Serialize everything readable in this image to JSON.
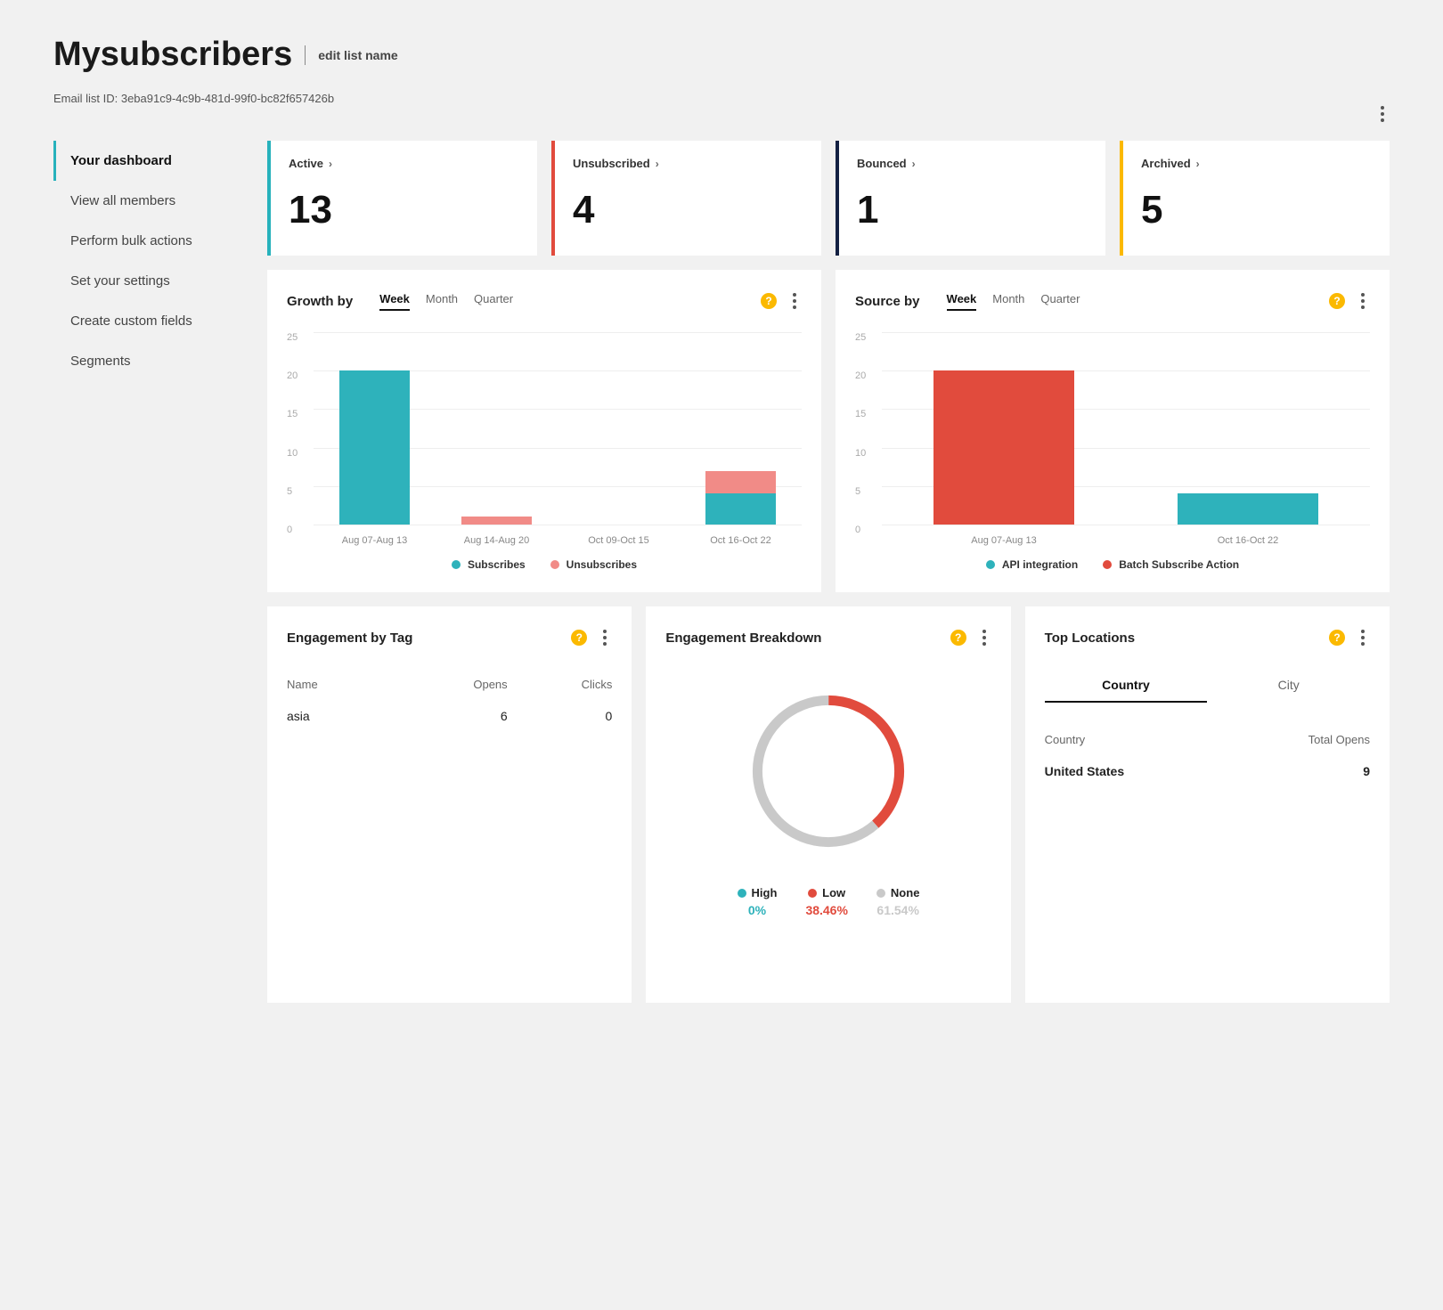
{
  "header": {
    "title": "Mysubscribers",
    "edit_link": "edit list name",
    "list_id_label": "Email list ID: 3eba91c9-4c9b-481d-99f0-bc82f657426b"
  },
  "sidebar": {
    "items": [
      {
        "label": "Your dashboard",
        "active": true
      },
      {
        "label": "View all members",
        "active": false
      },
      {
        "label": "Perform bulk actions",
        "active": false
      },
      {
        "label": "Set your settings",
        "active": false
      },
      {
        "label": "Create custom fields",
        "active": false
      },
      {
        "label": "Segments",
        "active": false
      }
    ]
  },
  "stats": [
    {
      "label": "Active",
      "value": "13",
      "color": "c-teal"
    },
    {
      "label": "Unsubscribed",
      "value": "4",
      "color": "c-red"
    },
    {
      "label": "Bounced",
      "value": "1",
      "color": "c-navy"
    },
    {
      "label": "Archived",
      "value": "5",
      "color": "c-yel"
    }
  ],
  "period_tabs": [
    {
      "label": "Week",
      "active": true
    },
    {
      "label": "Month",
      "active": false
    },
    {
      "label": "Quarter",
      "active": false
    }
  ],
  "growth_card": {
    "title": "Growth by"
  },
  "source_card": {
    "title": "Source by"
  },
  "chart_data": [
    {
      "id": "growth",
      "type": "bar",
      "title": "Growth by (Week)",
      "ylabel": "",
      "ylim": [
        0,
        25
      ],
      "yticks": [
        0,
        5,
        10,
        15,
        20,
        25
      ],
      "categories": [
        "Aug 07-Aug 13",
        "Aug 14-Aug 20",
        "Oct 09-Oct 15",
        "Oct 16-Oct 22"
      ],
      "series": [
        {
          "name": "Subscribes",
          "color": "#2eb2bb",
          "values": [
            20,
            0,
            0,
            4
          ]
        },
        {
          "name": "Unsubscribes",
          "color": "#f18b87",
          "values": [
            0,
            1,
            0,
            3
          ]
        }
      ]
    },
    {
      "id": "source",
      "type": "bar",
      "title": "Source by (Week)",
      "ylabel": "",
      "ylim": [
        0,
        25
      ],
      "yticks": [
        0,
        5,
        10,
        15,
        20,
        25
      ],
      "categories": [
        "Aug 07-Aug 13",
        "Oct 16-Oct 22"
      ],
      "series": [
        {
          "name": "API integration",
          "color": "#2eb2bb",
          "values": [
            0,
            4
          ]
        },
        {
          "name": "Batch Subscribe Action",
          "color": "#e14b3d",
          "values": [
            20,
            0
          ]
        }
      ]
    },
    {
      "id": "engagement_breakdown",
      "type": "pie",
      "title": "Engagement Breakdown",
      "series": [
        {
          "name": "High",
          "color": "#2eb2bb",
          "value": 0,
          "pct": "0%"
        },
        {
          "name": "Low",
          "color": "#e14b3d",
          "value": 38.46,
          "pct": "38.46%"
        },
        {
          "name": "None",
          "color": "#c9c9c9",
          "value": 61.54,
          "pct": "61.54%"
        }
      ]
    }
  ],
  "engagement_tag": {
    "title": "Engagement by Tag",
    "headers": {
      "name": "Name",
      "opens": "Opens",
      "clicks": "Clicks"
    },
    "rows": [
      {
        "name": "asia",
        "opens": "6",
        "clicks": "0"
      }
    ]
  },
  "engagement_breakdown": {
    "title": "Engagement Breakdown"
  },
  "top_locations": {
    "title": "Top Locations",
    "tabs": [
      {
        "label": "Country",
        "active": true
      },
      {
        "label": "City",
        "active": false
      }
    ],
    "headers": {
      "country": "Country",
      "opens": "Total Opens"
    },
    "rows": [
      {
        "country": "United States",
        "opens": "9"
      }
    ]
  }
}
